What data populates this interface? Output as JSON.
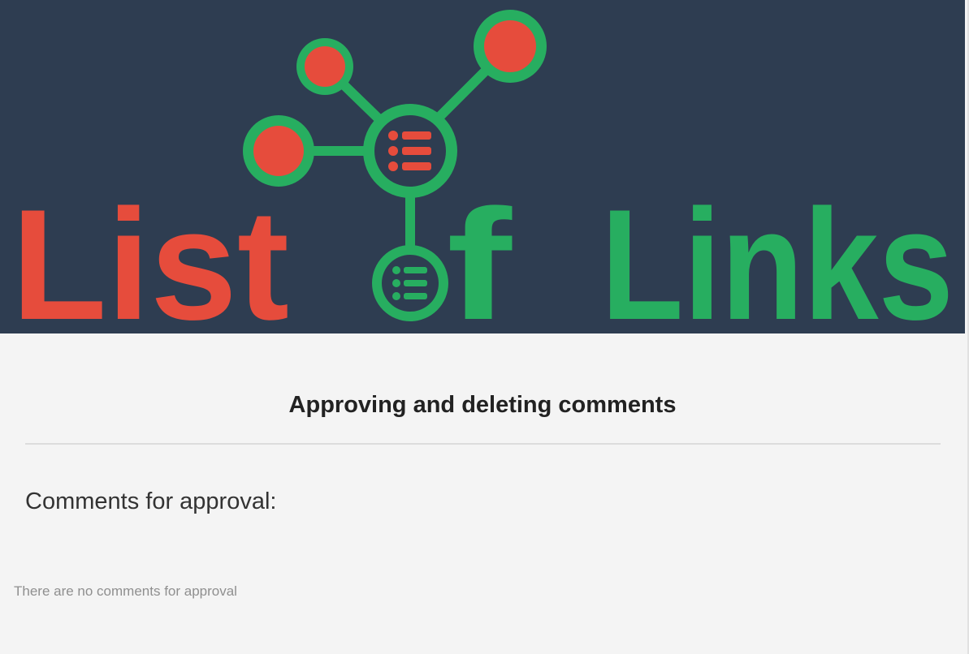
{
  "logo": {
    "text_list": "List",
    "text_of": "f",
    "text_links": "Links",
    "colors": {
      "background": "#2e3d51",
      "red": "#e64c3c",
      "green": "#27ae60"
    }
  },
  "page": {
    "heading": "Approving and deleting comments",
    "section_title": "Comments for approval:",
    "empty_message": "There are no comments for approval"
  }
}
